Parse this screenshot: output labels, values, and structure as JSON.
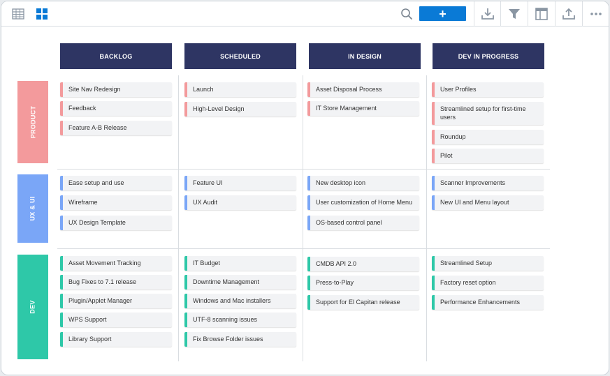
{
  "toolbar": {
    "left_icons": [
      "table-view-icon",
      "board-view-icon"
    ],
    "add_label": "+",
    "right_icons": [
      "download-icon",
      "filter-icon",
      "layout-icon",
      "upload-icon",
      "more-icon"
    ]
  },
  "colors": {
    "header_bg": "#2e3563",
    "product": "#f39a9c",
    "ux": "#7aa6f7",
    "dev": "#2ec8a8",
    "accent_blue": "#0a7ad6"
  },
  "columns": [
    {
      "label": "BACKLOG"
    },
    {
      "label": "SCHEDULED"
    },
    {
      "label": "IN DESIGN"
    },
    {
      "label": "DEV IN PROGRESS"
    }
  ],
  "rows": [
    {
      "label": "PRODUCT",
      "cells": [
        [
          "Site Nav Redesign",
          "Feedback",
          "Feature A-B Release"
        ],
        [
          "Launch",
          "High-Level Design"
        ],
        [
          "Asset Disposal Process",
          "IT Store Management"
        ],
        [
          "User Profiles",
          "Streamlined setup for first-time users",
          "Roundup",
          "Pilot"
        ]
      ]
    },
    {
      "label": "UX & UI",
      "cells": [
        [
          "Ease setup and use",
          "Wireframe",
          "UX Design Template"
        ],
        [
          "Feature UI",
          "UX Audit"
        ],
        [
          "New desktop icon",
          "User customization of Home Menu",
          "OS-based control panel"
        ],
        [
          "Scanner Improvements",
          "New UI and Menu layout"
        ]
      ]
    },
    {
      "label": "DEV",
      "cells": [
        [
          "Asset Movement Tracking",
          "Bug Fixes to 7.1 release",
          "Plugin/Applet Manager",
          "WPS Support",
          "Library Support"
        ],
        [
          "IT Budget",
          "Downtime Management",
          "Windows and Mac installers",
          "UTF-8 scanning issues",
          "Fix Browse Folder issues"
        ],
        [
          "CMDB API 2.0",
          "Press-to-Play",
          "Support for El Capitan release"
        ],
        [
          "Streamlined Setup",
          "Factory reset option",
          "Performance Enhancements"
        ]
      ]
    }
  ]
}
